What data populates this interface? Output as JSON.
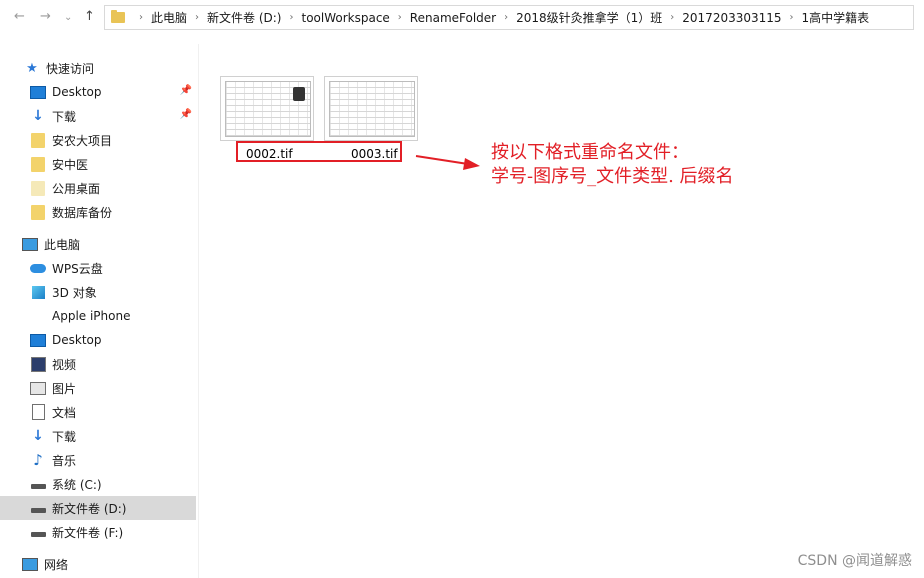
{
  "nav": {
    "back": "←",
    "forward": "→",
    "recent": "⌄",
    "up": "↑"
  },
  "breadcrumb": [
    "此电脑",
    "新文件卷 (D:)",
    "toolWorkspace",
    "RenameFolder",
    "2018级针灸推拿学（1）班",
    "2017203303115",
    "1高中学籍表"
  ],
  "sidebar": {
    "items": [
      {
        "label": "快速访问",
        "icon": "star-icon"
      },
      {
        "label": "Desktop",
        "icon": "desktop-icon",
        "pinned": true
      },
      {
        "label": "下载",
        "icon": "download-icon",
        "pinned": true
      },
      {
        "label": "安农大项目",
        "icon": "folder-icon"
      },
      {
        "label": "安中医",
        "icon": "folder-icon"
      },
      {
        "label": "公用桌面",
        "icon": "folder-icon"
      },
      {
        "label": "数据库备份",
        "icon": "folder-icon"
      },
      {
        "label": "此电脑",
        "icon": "computer-icon"
      },
      {
        "label": "WPS云盘",
        "icon": "cloud-icon"
      },
      {
        "label": "3D 对象",
        "icon": "cube-icon"
      },
      {
        "label": "Apple iPhone",
        "icon": "phone-icon"
      },
      {
        "label": "Desktop",
        "icon": "desktop-icon"
      },
      {
        "label": "视频",
        "icon": "video-icon"
      },
      {
        "label": "图片",
        "icon": "picture-icon"
      },
      {
        "label": "文档",
        "icon": "document-icon"
      },
      {
        "label": "下载",
        "icon": "download-icon"
      },
      {
        "label": "音乐",
        "icon": "music-icon"
      },
      {
        "label": "系统 (C:)",
        "icon": "drive-icon"
      },
      {
        "label": "新文件卷 (D:)",
        "icon": "drive-icon",
        "selected": true
      },
      {
        "label": "新文件卷 (F:)",
        "icon": "drive-icon"
      },
      {
        "label": "网络",
        "icon": "network-icon"
      }
    ]
  },
  "files": [
    {
      "name": "0002.tif"
    },
    {
      "name": "0003.tif"
    }
  ],
  "annotation": {
    "line1": "按以下格式重命名文件：",
    "line2": "学号-图序号_文件类型. 后缀名",
    "color": "#e21f26"
  },
  "watermark": "CSDN @闻道解惑"
}
